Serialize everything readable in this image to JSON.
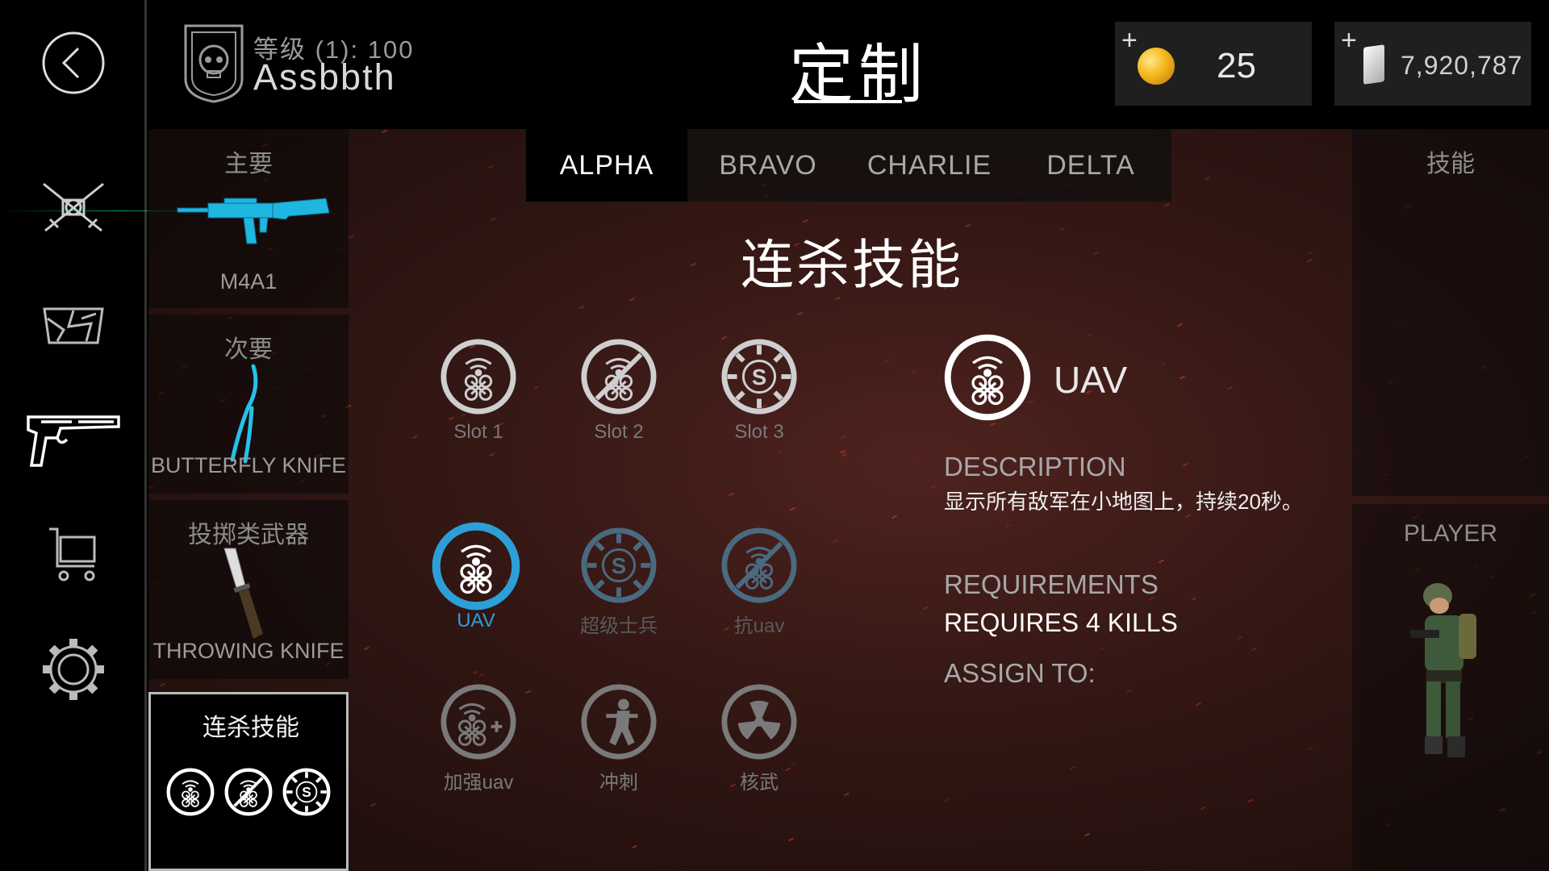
{
  "header": {
    "level_text": "等级 (1): 100",
    "player_name": "Assbbth",
    "page_title": "定制",
    "coins": "25",
    "cash": "7,920,787",
    "plus": "+"
  },
  "nav": {
    "items": [
      "back-icon",
      "crossed-rifles-icon",
      "camo-icon",
      "pistol-icon",
      "cart-icon",
      "gear-icon"
    ]
  },
  "loadout": {
    "primary": {
      "title": "主要",
      "name": "M4A1"
    },
    "secondary": {
      "title": "次要",
      "name": "BUTTERFLY KNIFE"
    },
    "throwable": {
      "title": "投掷类武器",
      "name": "THROWING KNIFE"
    },
    "killstreak": {
      "title": "连杀技能"
    }
  },
  "right": {
    "skills_label": "技能",
    "player_label": "PLAYER"
  },
  "tabs": [
    "ALPHA",
    "BRAVO",
    "CHARLIE",
    "DELTA"
  ],
  "active_tab": "ALPHA",
  "section_title": "连杀技能",
  "slots": [
    {
      "label": "Slot 1",
      "icon": "drone-icon"
    },
    {
      "label": "Slot 2",
      "icon": "anti-drone-icon"
    },
    {
      "label": "Slot 3",
      "icon": "super-soldier-icon"
    }
  ],
  "killstreaks": [
    {
      "label": "UAV",
      "icon": "drone-icon",
      "state": "selected"
    },
    {
      "label": "超级士兵",
      "icon": "super-soldier-icon",
      "state": "dim"
    },
    {
      "label": "抗uav",
      "icon": "anti-drone-icon",
      "state": "dim"
    },
    {
      "label": "加强uav",
      "icon": "drone-plus-icon",
      "state": "normal"
    },
    {
      "label": "冲刺",
      "icon": "soldier-icon",
      "state": "normal"
    },
    {
      "label": "核武",
      "icon": "nuke-icon",
      "state": "normal"
    }
  ],
  "detail": {
    "name": "UAV",
    "description_head": "DESCRIPTION",
    "description": "显示所有敌军在小地图上，持续20秒。",
    "requirements_head": "REQUIREMENTS",
    "requirements": "REQUIRES 4 KILLS",
    "assign_head": "ASSIGN TO:"
  },
  "colors": {
    "accent_blue": "#2c9fd8",
    "coin_gold": "#f6b51c",
    "background_red": "#2a1613"
  }
}
